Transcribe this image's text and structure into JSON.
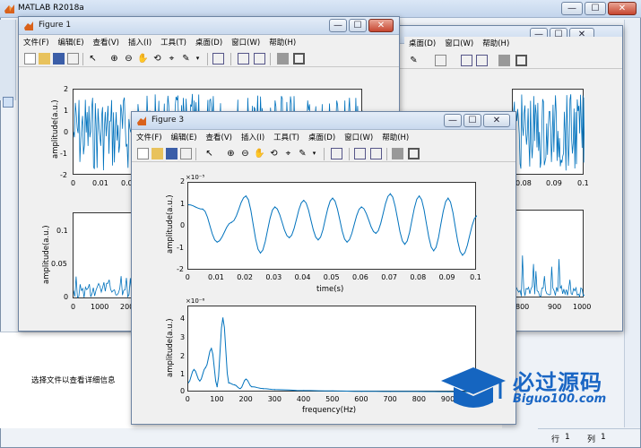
{
  "main_window": {
    "title": "MATLAB R2018a",
    "btn_min": "—",
    "btn_max": "☐",
    "btn_close": "✕"
  },
  "details_panel": {
    "hint": "选择文件以查看详细信息"
  },
  "status_bar": {
    "row_label": "行",
    "row": "1",
    "col_label": "列",
    "col": "1"
  },
  "logo": {
    "brand": "必过源码",
    "url": "Biguo100.com"
  },
  "menus": [
    "文件(F)",
    "编辑(E)",
    "查看(V)",
    "插入(I)",
    "工具(T)",
    "桌面(D)",
    "窗口(W)",
    "帮助(H)"
  ],
  "figure1": {
    "title": "Figure 1",
    "top_plot": {
      "ylabel": "amplitude(a.u.)",
      "yticks": [
        "2",
        "1",
        "0",
        "-1",
        "-2"
      ],
      "xticks": [
        "0",
        "0.01",
        "0.02"
      ]
    },
    "bottom_plot": {
      "ylabel": "amplitude(a.u.)",
      "yticks": [
        "0.1",
        "0.05",
        "0"
      ],
      "xticks": [
        "0",
        "1000",
        "200"
      ]
    }
  },
  "figure2": {
    "top_plot": {
      "xticks": [
        "0.08",
        "0.09",
        "0.1"
      ]
    },
    "bottom_plot": {
      "xticks": [
        "800",
        "900",
        "1000"
      ]
    }
  },
  "figure3": {
    "title": "Figure 3",
    "top_plot": {
      "ylabel": "amplitude(a.u.)",
      "xlabel": "time(s)",
      "exponent": "×10⁻⁵",
      "yticks": [
        "2",
        "1",
        "0",
        "-1",
        "-2"
      ],
      "xticks": [
        "0",
        "0.01",
        "0.02",
        "0.03",
        "0.04",
        "0.05",
        "0.06",
        "0.07",
        "0.08",
        "0.09",
        "0.1"
      ]
    },
    "bottom_plot": {
      "ylabel": "amplitude(a.u.)",
      "xlabel": "frequency(Hz)",
      "exponent": "×10⁻⁶",
      "yticks": [
        "4",
        "3",
        "2",
        "1",
        "0"
      ],
      "xticks": [
        "0",
        "100",
        "200",
        "300",
        "400",
        "500",
        "600",
        "700",
        "800",
        "900"
      ]
    }
  },
  "chart_data": [
    {
      "type": "line",
      "figure": "Figure 3 top",
      "xlabel": "time(s)",
      "ylabel": "amplitude(a.u.)",
      "xlim": [
        0,
        0.1
      ],
      "ylim": [
        -2e-05,
        2e-05
      ],
      "x": [
        0,
        0.005,
        0.01,
        0.015,
        0.02,
        0.025,
        0.03,
        0.035,
        0.04,
        0.045,
        0.05,
        0.055,
        0.06,
        0.065,
        0.07,
        0.075,
        0.08,
        0.085,
        0.09,
        0.095,
        0.1
      ],
      "y": [
        1e-05,
        8e-06,
        -7e-06,
        2e-06,
        1.4e-05,
        -1.2e-05,
        9e-06,
        -5e-06,
        1.2e-05,
        -6e-06,
        1.3e-05,
        -7e-06,
        9e-06,
        -3e-06,
        1.5e-05,
        -8e-06,
        1.4e-05,
        -1.1e-05,
        1.3e-05,
        -1.3e-05,
        5e-06
      ]
    },
    {
      "type": "line",
      "figure": "Figure 3 bottom",
      "xlabel": "frequency(Hz)",
      "ylabel": "amplitude(a.u.)",
      "xlim": [
        0,
        1000
      ],
      "ylim": [
        0,
        4.5e-06
      ],
      "x": [
        0,
        20,
        40,
        60,
        80,
        100,
        120,
        140,
        160,
        180,
        200,
        220,
        260,
        300,
        400,
        500,
        600,
        700,
        800,
        900,
        1000
      ],
      "y": [
        5e-07,
        1.2e-06,
        6e-07,
        1.3e-06,
        2.3e-06,
        3e-07,
        3.9e-06,
        5e-07,
        4e-07,
        2e-07,
        7e-07,
        3e-07,
        2e-07,
        1.5e-07,
        1e-07,
        8e-08,
        6e-08,
        5e-08,
        5e-08,
        4e-08,
        3e-08
      ]
    }
  ]
}
